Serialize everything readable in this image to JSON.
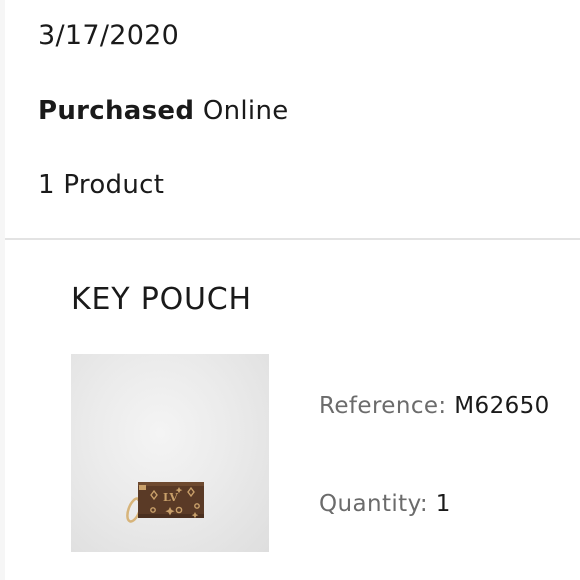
{
  "order": {
    "date": "3/17/2020",
    "purchase_bold": "Purchased",
    "purchase_channel": "Online",
    "product_count": "1 Product"
  },
  "product": {
    "name": "KEY POUCH",
    "image_icon": "monogram-key-pouch-image",
    "reference_label": "Reference:",
    "reference_value": "M62650",
    "quantity_label": "Quantity:",
    "quantity_value": "1"
  },
  "colors": {
    "background": "#f6f6f6",
    "card": "#ffffff",
    "text": "#1a1a1a",
    "label": "#6b6b6b",
    "divider": "#e3e3e3",
    "canvas_brown": "#5a3a26",
    "monogram_gold": "#c9a06a"
  }
}
